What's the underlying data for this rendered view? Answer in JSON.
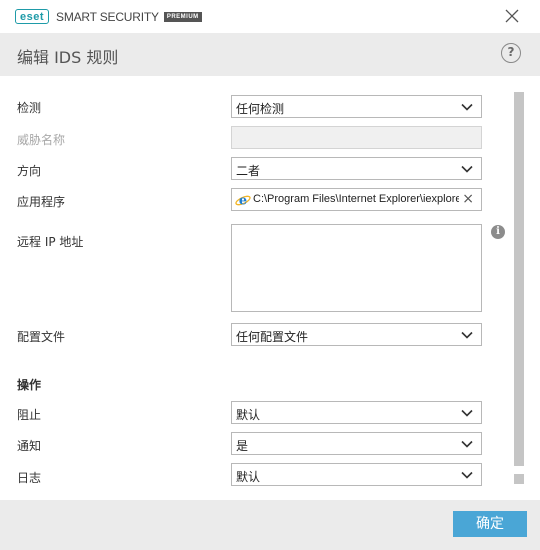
{
  "titlebar": {
    "logo_text": "eset",
    "product_name": "SMART SECURITY",
    "edition_badge": "PREMIUM",
    "close_icon": "close-icon"
  },
  "header": {
    "title": "编辑 IDS 规则",
    "help_label": "?"
  },
  "form": {
    "detection": {
      "label": "检测",
      "value": "任何检测"
    },
    "threat_name": {
      "label": "威胁名称",
      "value": ""
    },
    "direction": {
      "label": "方向",
      "value": "二者"
    },
    "application": {
      "label": "应用程序",
      "value": "C:\\Program Files\\Internet Explorer\\iexplore.exe",
      "clear_label": "×",
      "icon": "internet-explorer-icon"
    },
    "remote_ip": {
      "label": "远程 IP 地址",
      "value": "",
      "info_label": "i"
    },
    "profile": {
      "label": "配置文件",
      "value": "任何配置文件"
    }
  },
  "actions": {
    "section_title": "操作",
    "block": {
      "label": "阻止",
      "value": "默认"
    },
    "notify": {
      "label": "通知",
      "value": "是"
    },
    "log": {
      "label": "日志",
      "value": "默认"
    }
  },
  "footer": {
    "ok_label": "确定"
  },
  "colors": {
    "brand": "#1e9ba8",
    "header_bg": "#ebebeb",
    "primary_button": "#4aa6d6"
  }
}
